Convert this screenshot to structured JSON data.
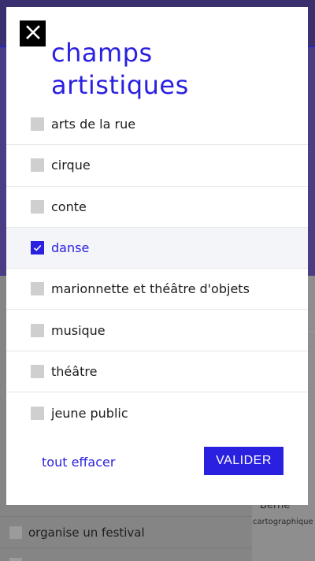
{
  "modal": {
    "title": "champs artistiques",
    "options": [
      {
        "label": "arts de la rue",
        "checked": false
      },
      {
        "label": "cirque",
        "checked": false
      },
      {
        "label": "conte",
        "checked": false
      },
      {
        "label": "danse",
        "checked": true
      },
      {
        "label": "marionnette et théâtre d'objets",
        "checked": false
      },
      {
        "label": "musique",
        "checked": false
      },
      {
        "label": "théâtre",
        "checked": false
      },
      {
        "label": "jeune public",
        "checked": false
      }
    ],
    "clear_label": "tout effacer",
    "validate_label": "VALIDER",
    "close_icon": "close-icon"
  },
  "background": {
    "list_items": [
      {
        "label": "organise un festival"
      },
      {
        "label": ""
      }
    ],
    "map_city": "Berne",
    "map_credit": "cartographique"
  },
  "colors": {
    "accent": "#2a20e0",
    "overlay": "#7d7d7d",
    "checkbox_unchecked": "#cfcfcf",
    "selected_row_bg": "#f4f5f9"
  }
}
